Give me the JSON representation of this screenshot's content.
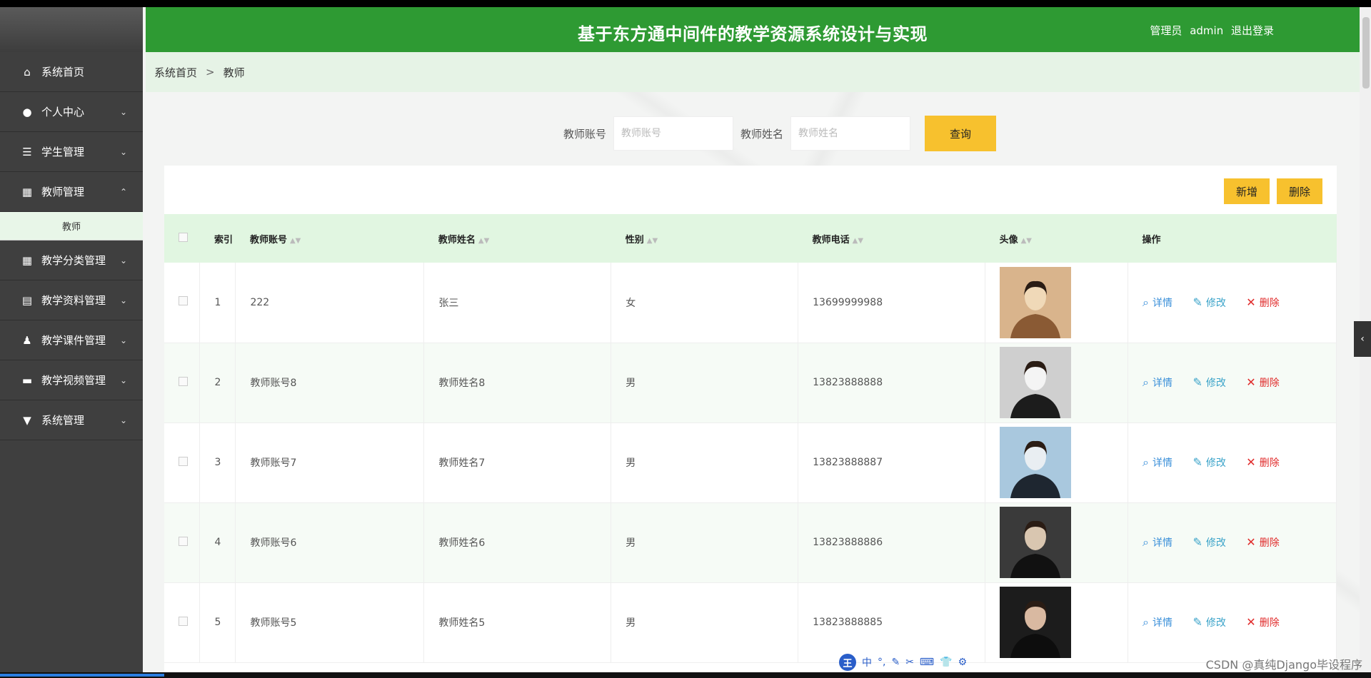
{
  "header": {
    "title": "基于东方通中间件的教学资源系统设计与实现",
    "role": "管理员",
    "username": "admin",
    "logout": "退出登录"
  },
  "sidebar": {
    "items": [
      {
        "label": "系统首页",
        "icon": "home-icon",
        "chevron": ""
      },
      {
        "label": "个人中心",
        "icon": "user-icon",
        "chevron": "⌄"
      },
      {
        "label": "学生管理",
        "icon": "list-icon",
        "chevron": "⌄"
      },
      {
        "label": "教师管理",
        "icon": "grid-icon",
        "chevron": "⌃"
      },
      {
        "label": "教学分类管理",
        "icon": "grid-icon",
        "chevron": "⌄"
      },
      {
        "label": "教学资料管理",
        "icon": "table-icon",
        "chevron": "⌄"
      },
      {
        "label": "教学课件管理",
        "icon": "person-icon",
        "chevron": "⌄"
      },
      {
        "label": "教学视频管理",
        "icon": "monitor-icon",
        "chevron": "⌄"
      },
      {
        "label": "系统管理",
        "icon": "pin-icon",
        "chevron": "⌄"
      }
    ],
    "sub_item": "教师"
  },
  "breadcrumb": {
    "home": "系统首页",
    "separator": ">",
    "current": "教师"
  },
  "search": {
    "account_label": "教师账号",
    "account_placeholder": "教师账号",
    "name_label": "教师姓名",
    "name_placeholder": "教师姓名",
    "query_button": "查询"
  },
  "actions": {
    "add": "新增",
    "delete": "删除"
  },
  "table": {
    "columns": [
      "索引",
      "教师账号",
      "教师姓名",
      "性别",
      "教师电话",
      "头像",
      "操作"
    ],
    "rows": [
      {
        "index": "1",
        "account": "222",
        "name": "张三",
        "gender": "女",
        "phone": "13699999988"
      },
      {
        "index": "2",
        "account": "教师账号8",
        "name": "教师姓名8",
        "gender": "男",
        "phone": "13823888888"
      },
      {
        "index": "3",
        "account": "教师账号7",
        "name": "教师姓名7",
        "gender": "男",
        "phone": "13823888887"
      },
      {
        "index": "4",
        "account": "教师账号6",
        "name": "教师姓名6",
        "gender": "男",
        "phone": "13823888886"
      },
      {
        "index": "5",
        "account": "教师账号5",
        "name": "教师姓名5",
        "gender": "男",
        "phone": "13823888885"
      }
    ],
    "ops": {
      "detail": "详情",
      "edit": "修改",
      "delete": "删除"
    }
  },
  "ime": {
    "logo": "王",
    "mode": "中"
  },
  "watermark": "CSDN @真纯Django毕设程序",
  "colors": {
    "header": "#2e9a33",
    "sidebar": "#3f3f3f",
    "accent_yellow": "#f7c12e",
    "table_head": "#e1f6e1"
  }
}
